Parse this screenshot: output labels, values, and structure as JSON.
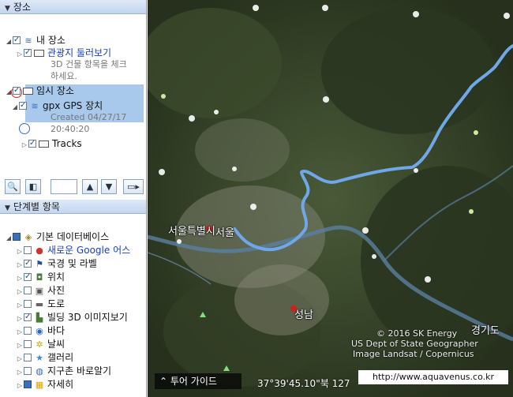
{
  "places_panel": {
    "title": "장소",
    "my_places": "내 장소",
    "sightseeing": "관광지 둘러보기",
    "sightseeing_hint_1": "3D 건물 항목을 체크",
    "sightseeing_hint_2": "하세요.",
    "temp_places": "임시 장소",
    "gpx_device": "gpx GPS 장치",
    "gpx_created_1": "Created 04/27/17",
    "gpx_created_2": "20:40:20",
    "tracks": "Tracks"
  },
  "toolbar": {
    "search_icon": "magnifier-icon",
    "panel_icon": "panel-toggle-icon",
    "up_icon": "up-arrow-icon",
    "down_icon": "down-arrow-icon",
    "folder_icon": "folder-menu-icon"
  },
  "layers_panel": {
    "title": "단계별 항목",
    "items": [
      {
        "label": "기본 데이터베이스"
      },
      {
        "label": "새로운 Google 어스"
      },
      {
        "label": "국경 및 라벨"
      },
      {
        "label": "위치"
      },
      {
        "label": "사진"
      },
      {
        "label": "도로"
      },
      {
        "label": "빌딩 3D 이미지보기"
      },
      {
        "label": "바다"
      },
      {
        "label": "날씨"
      },
      {
        "label": "갤러리"
      },
      {
        "label": "지구촌 바로알기"
      },
      {
        "label": "자세히"
      }
    ]
  },
  "map": {
    "city_seoul_1": "서울특별시",
    "city_seoul_2": "서울",
    "city_seongnam": "성남",
    "province": "경기도",
    "copyright_1": "© 2016 SK Energy",
    "copyright_2": "US Dept of State Geographer",
    "copyright_3": "Image Landsat / Copernicus",
    "coordinates": "37°39'45.10\"북 127",
    "tour_guide": "투어 가이드",
    "watermark": "http://www.aquavenus.co.kr",
    "track_color": "#6fa8e8"
  }
}
